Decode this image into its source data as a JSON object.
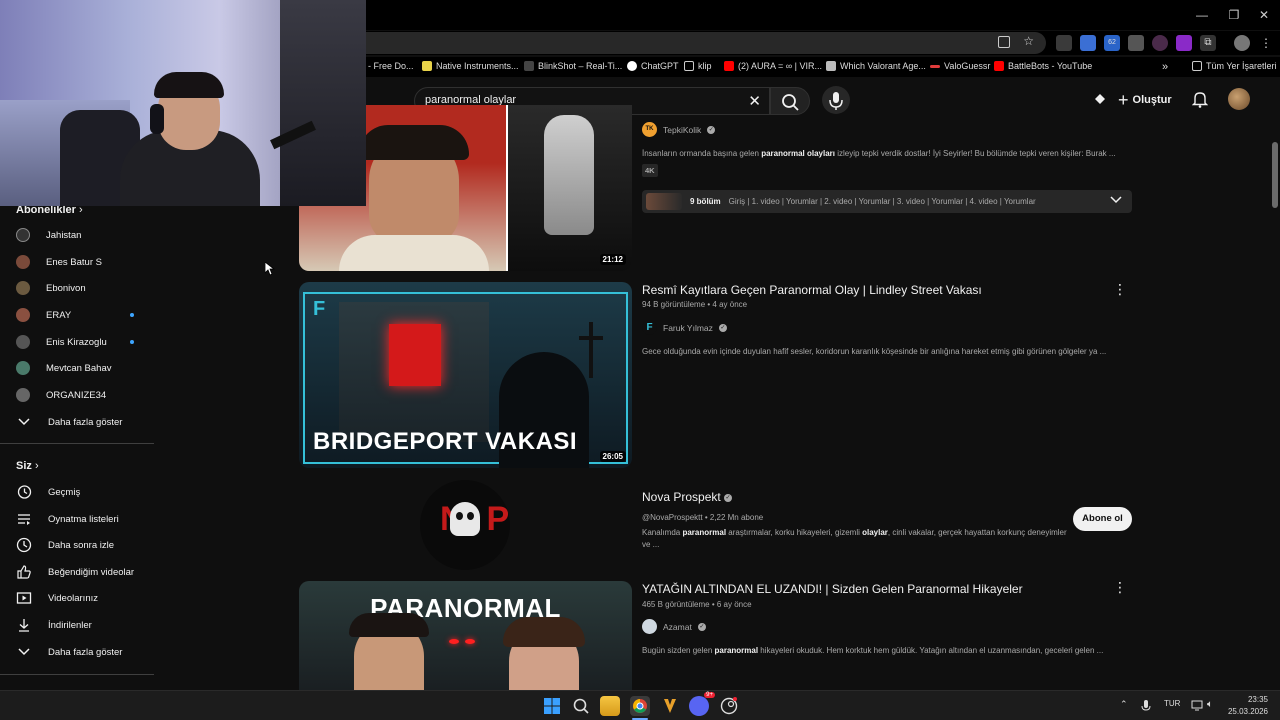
{
  "browser": {
    "window_controls": {
      "minimize": "—",
      "maximize": "❐",
      "close": "✕"
    },
    "bookmarks": [
      {
        "label": "- Free Do...",
        "color": "#ffffff"
      },
      {
        "label": "Native Instruments...",
        "color": "#e8d34a"
      },
      {
        "label": "BlinkShot – Real-Ti...",
        "color": "#444444"
      },
      {
        "label": "ChatGPT",
        "color": "#ffffff"
      },
      {
        "label": "klip",
        "color": "#cccccc"
      },
      {
        "label": "(2) AURA = ∞ | VIR...",
        "color": "#ff0000"
      },
      {
        "label": "Which Valorant Age...",
        "color": "#bbbbbb"
      },
      {
        "label": "ValoGuessr",
        "color": "#e03c3c"
      },
      {
        "label": "BattleBots - YouTube",
        "color": "#ff0000"
      }
    ],
    "bookmarks_more": "»",
    "all_bookmarks": "Tüm Yer İşaretleri"
  },
  "header": {
    "search_query": "paranormal olaylar",
    "create_label": "Oluştur"
  },
  "sidebar": {
    "subscriptions_title": "Abonelikler",
    "subscriptions": [
      {
        "label": "Jahistan",
        "color": "#333333",
        "new": false
      },
      {
        "label": "Enes Batur S",
        "color": "#7a4a3a",
        "new": false
      },
      {
        "label": "Ebonivon",
        "color": "#6b5a40",
        "new": false
      },
      {
        "label": "ERAY",
        "color": "#8a5040",
        "new": true
      },
      {
        "label": "Enis Kirazoglu",
        "color": "#555555",
        "new": true
      },
      {
        "label": "Mevtcan Bahav",
        "color": "#4a7a6a",
        "new": false
      },
      {
        "label": "ORGANIZE34",
        "color": "#666666",
        "new": false
      }
    ],
    "show_more_subs": "Daha fazla göster",
    "you_title": "Siz",
    "you_items": [
      {
        "label": "Geçmiş",
        "icon": "history-icon"
      },
      {
        "label": "Oynatma listeleri",
        "icon": "playlist-icon"
      },
      {
        "label": "Daha sonra izle",
        "icon": "clock-icon"
      },
      {
        "label": "Beğendiğim videolar",
        "icon": "thumbs-up-icon"
      },
      {
        "label": "Videolarınız",
        "icon": "video-icon"
      },
      {
        "label": "İndirilenler",
        "icon": "download-icon"
      }
    ],
    "show_more_you": "Daha fazla göster"
  },
  "results": {
    "first": {
      "channel": "TepkiKolik",
      "channel_initials": "TK",
      "desc_pre": "İnsanların ormanda başına gelen ",
      "desc_bold": "paranormal olayları",
      "desc_post": " izleyip tepki verdik dostlar! İyi Seyirler! Bu bölümde tepki veren kişiler: Burak ...",
      "badge": "4K",
      "duration": "21:12",
      "chapters_count": "9 bölüm",
      "chapters_text": "Giriş | 1. video | Yorumlar | 2. video | Yorumlar | 3. video | Yorumlar | 4. video | Yorumlar"
    },
    "second": {
      "title": "Resmî Kayıtlara Geçen Paranormal Olay | Lindley Street Vakası",
      "meta": "94 B görüntüleme • 4 ay önce",
      "channel": "Faruk Yılmaz",
      "desc": "Gece olduğunda evin içinde duyulan hafif sesler, koridorun karanlık köşesinde bir anlığına hareket etmiş gibi görünen gölgeler ya ...",
      "thumb_text": "BRIDGEPORT VAKASI",
      "thumb_letter": "F",
      "duration": "26:05"
    },
    "channel_result": {
      "name": "Nova Prospekt",
      "meta": "@NovaProspektt • 2,22 Mn abone",
      "desc_1": "Kanalımda ",
      "desc_b1": "paranormal",
      "desc_2": " araştırmalar, korku hikayeleri, gizemli ",
      "desc_b2": "olaylar",
      "desc_3": ", cinli vakalar, gerçek hayattan korkunç deneyimler",
      "desc_line2": "ve ...",
      "logo_text": "NP",
      "subscribe_label": "Abone ol"
    },
    "third": {
      "title": "YATAĞIN ALTINDAN EL UZANDI! | Sizden Gelen Paranormal Hikayeler",
      "meta": "465 B görüntüleme • 6 ay önce",
      "channel": "Azamat",
      "desc_pre": "Bugün sizden gelen ",
      "desc_bold": "paranormal",
      "desc_post": " hikayeleri okuduk. Hem korktuk hem güldük. Yatağın altından el uzanmasından, geceleri gelen ...",
      "thumb_text": "PARANORMAL"
    }
  },
  "taskbar": {
    "lang": "TUR",
    "time": "23:35",
    "date": "25.03.2026",
    "discord_badge": "9+"
  }
}
